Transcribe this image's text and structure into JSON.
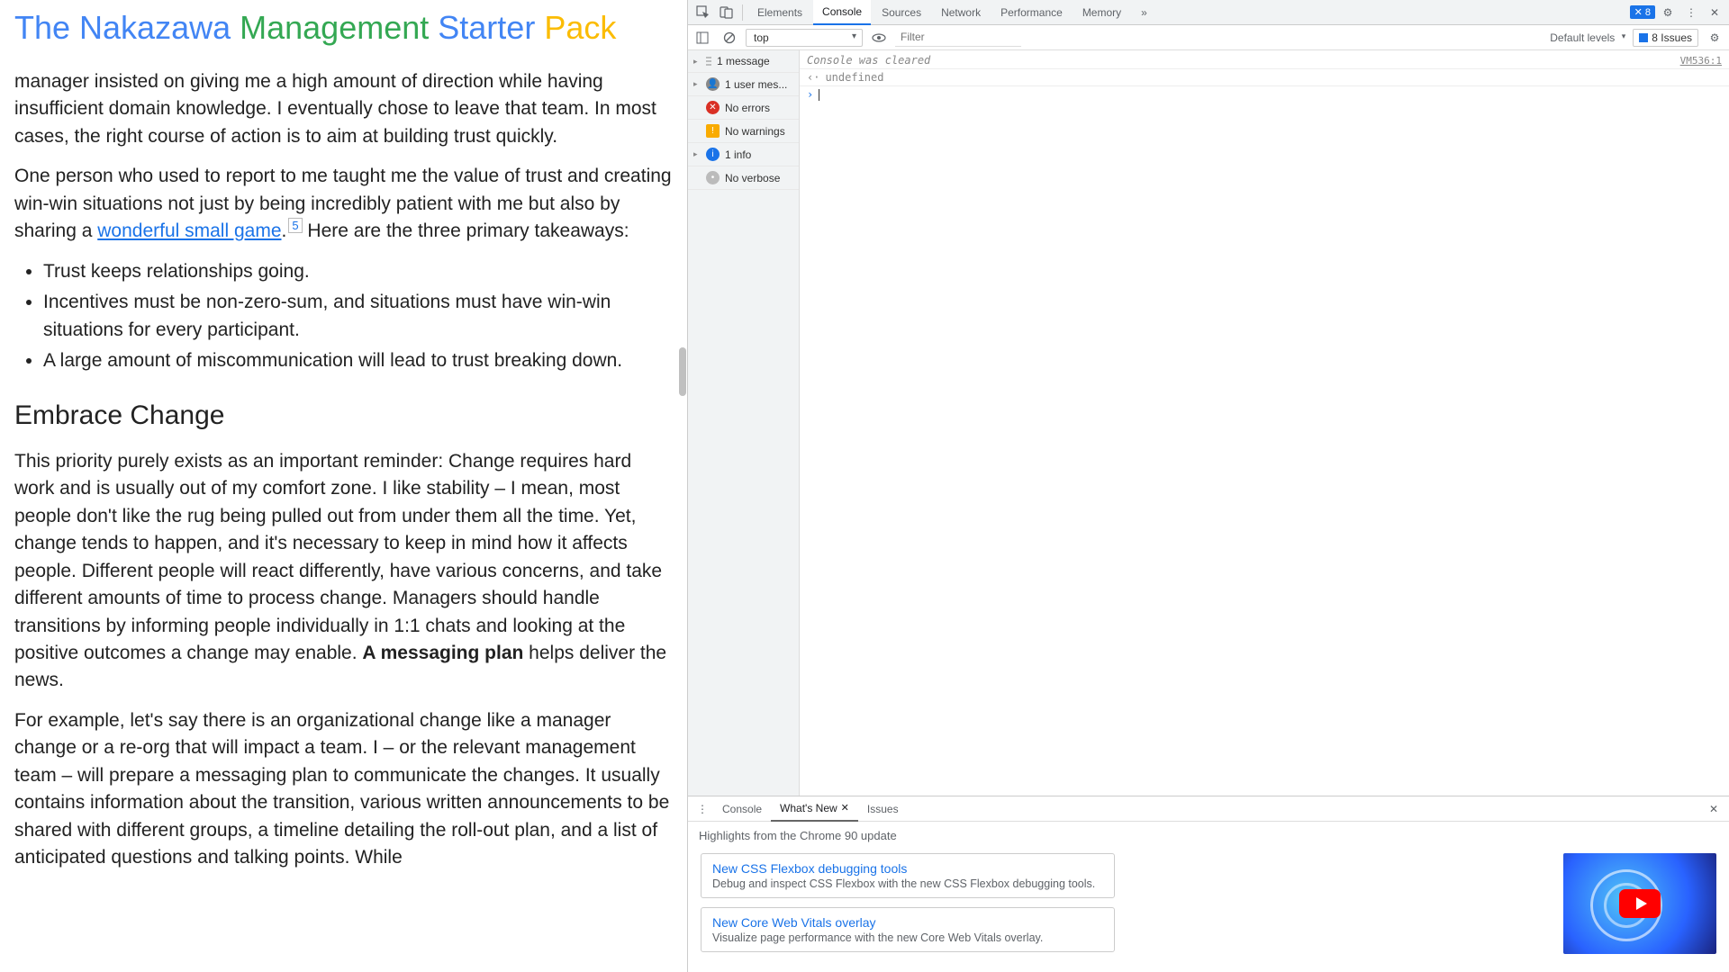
{
  "page": {
    "title_parts": [
      "The Nakazawa ",
      "Management ",
      "Starter ",
      "Pack"
    ],
    "p1": "manager insisted on giving me a high amount of direction while having insufficient domain knowledge. I eventually chose to leave that team. In most cases, the right course of action is to aim at building trust quickly.",
    "p2a": "One person who used to report to me taught me the value of trust and creating win-win situations not just by being incredibly patient with me but also by sharing a ",
    "p2_link": "wonderful small game",
    "p2b": ".",
    "p2_sup": "5",
    "p2c": " Here are the three primary takeaways:",
    "bullets": [
      "Trust keeps relationships going.",
      "Incentives must be non-zero-sum, and situations must have win-win situations for every participant.",
      "A large amount of miscommunication will lead to trust breaking down."
    ],
    "h2": "Embrace Change",
    "p3a": "This priority purely exists as an important reminder: Change requires hard work and is usually out of my comfort zone. I like stability – I mean, most people don't like the rug being pulled out from under them all the time. Yet, change tends to happen, and it's necessary to keep in mind how it affects people. Different people will react differently, have various concerns, and take different amounts of time to process change. Managers should handle transitions by informing people individually in 1:1 chats and looking at the positive outcomes a change may enable. ",
    "p3_bold": "A messaging plan",
    "p3b": " helps deliver the news.",
    "p4": "For example, let's say there is an organizational change like a manager change or a re-org that will impact a team. I – or the relevant management team – will prepare a messaging plan to communicate the changes. It usually contains information about the transition, various written announcements to be shared with different groups, a timeline detailing the roll-out plan, and a list of anticipated questions and talking points. While"
  },
  "dt": {
    "tabs": [
      "Elements",
      "Console",
      "Sources",
      "Network",
      "Performance",
      "Memory"
    ],
    "active_tab": "Console",
    "more": "»",
    "badge": "8",
    "context": "top",
    "filter_ph": "Filter",
    "levels": "Default levels",
    "issues_label": "8 Issues",
    "sidebar": [
      {
        "arrow": "▸",
        "icon": "msg",
        "text": "1 message"
      },
      {
        "arrow": "▸",
        "icon": "user",
        "text": "1 user mes..."
      },
      {
        "arrow": "",
        "icon": "err",
        "text": "No errors"
      },
      {
        "arrow": "",
        "icon": "warn",
        "text": "No warnings"
      },
      {
        "arrow": "▸",
        "icon": "info",
        "text": "1 info"
      },
      {
        "arrow": "",
        "icon": "verb",
        "text": "No verbose"
      }
    ],
    "console": {
      "cleared": "Console was cleared",
      "src": "VM536:1",
      "undef": "undefined"
    }
  },
  "drawer": {
    "tabs": [
      "Console",
      "What's New",
      "Issues"
    ],
    "active": "What's New",
    "subtitle": "Highlights from the Chrome 90 update",
    "cards": [
      {
        "title": "New CSS Flexbox debugging tools",
        "desc": "Debug and inspect CSS Flexbox with the new CSS Flexbox debugging tools."
      },
      {
        "title": "New Core Web Vitals overlay",
        "desc": "Visualize page performance with the new Core Web Vitals overlay."
      }
    ]
  }
}
